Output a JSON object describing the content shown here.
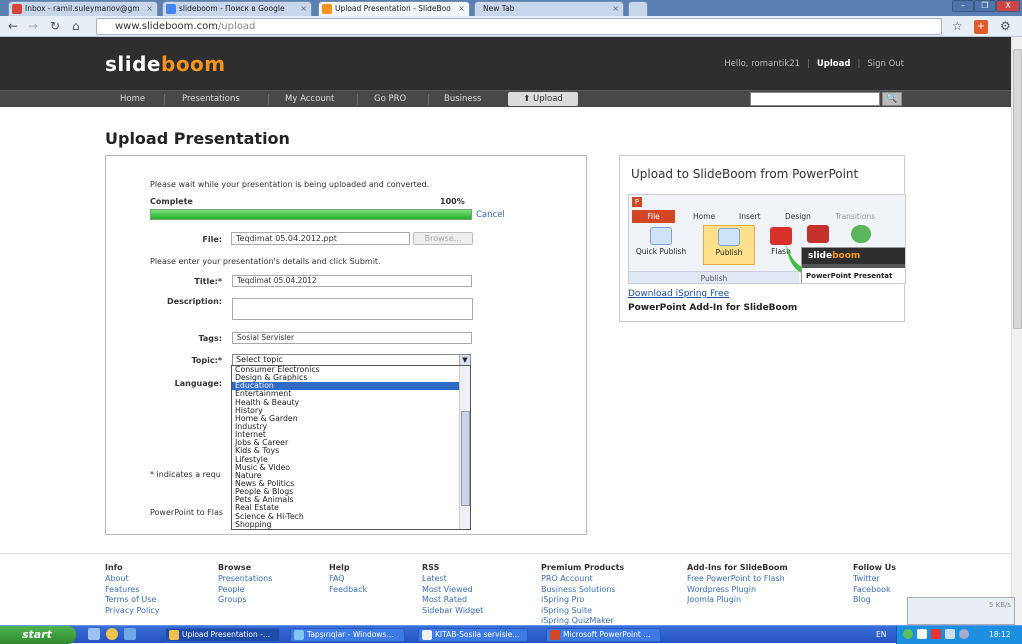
{
  "browser": {
    "tabs": [
      {
        "label": "Inbox - ramil.suleymanov@gm",
        "icon": "gmail-icon",
        "color": "#d44638"
      },
      {
        "label": "slideboom - Поиск в Google",
        "icon": "google-icon",
        "color": "#4285f4"
      },
      {
        "label": "Upload Presentation - SlideBoo",
        "icon": "slideboom-icon",
        "color": "#f7941d"
      },
      {
        "label": "New Tab",
        "icon": "",
        "color": ""
      }
    ],
    "url_host": "www.slideboom.com",
    "url_path": "/upload",
    "window_buttons": [
      "–",
      "❐",
      "X"
    ]
  },
  "site": {
    "logo_a": "slide",
    "logo_b": "boom",
    "greeting": "Hello, romantik21",
    "upload_link": "Upload",
    "signout_link": "Sign Out",
    "nav": [
      "Home",
      "Presentations",
      "My Account",
      "Go PRO",
      "Business"
    ],
    "nav_upload": "Upload",
    "brand_color": "#f7941d"
  },
  "page": {
    "title": "Upload Presentation",
    "wait_text": "Please wait while your presentation is being uploaded and converted.",
    "status_label": "Complete",
    "progress_percent": 100,
    "progress_text": "100%",
    "cancel_link": "Cancel",
    "file_label": "File:",
    "file_value": "Teqdimat 05.04.2012.ppt",
    "browse_label": "Browse...",
    "details_text": "Please enter your presentation's details and click Submit.",
    "title_label": "Title:*",
    "title_value": "Teqdimat 05.04.2012",
    "description_label": "Description:",
    "description_value": "",
    "tags_label": "Tags:",
    "tags_value": "Sosial Servisler",
    "topic_label": "Topic:*",
    "topic_value": "Select topic",
    "language_label": "Language:",
    "required_note": "* indicates a requ",
    "ppt_note": "PowerPoint to Flas",
    "topic_options": [
      "Consumer Electronics",
      "Design & Graphics",
      "Education",
      "Entertainment",
      "Health & Beauty",
      "History",
      "Home & Garden",
      "Industry",
      "Internet",
      "Jobs & Career",
      "Kids & Toys",
      "Lifestyle",
      "Music & Video",
      "Nature",
      "News & Politics",
      "People & Blogs",
      "Pets & Animals",
      "Real Estate",
      "Science & Hi-Tech",
      "Shopping"
    ],
    "topic_selected_index": 2
  },
  "promo": {
    "title": "Upload to SlideBoom from PowerPoint",
    "ribbon_file": "File",
    "ribbon_tabs": [
      "Home",
      "Insert",
      "Design",
      "Transitions"
    ],
    "quick_publish": "Quick Publish",
    "publish": "Publish",
    "flash": "Flash",
    "group_label": "Publish",
    "mini_logo_a": "slide",
    "mini_logo_b": "boom",
    "mini_text": "PowerPoint Presentat",
    "download_link": "Download iSpring Free",
    "download_sub": "PowerPoint Add-In for SlideBoom"
  },
  "footer": {
    "columns": [
      {
        "title": "Info",
        "links": [
          "About",
          "Features",
          "Terms of Use",
          "Privacy Policy"
        ]
      },
      {
        "title": "Browse",
        "links": [
          "Presentations",
          "People",
          "Groups"
        ]
      },
      {
        "title": "Help",
        "links": [
          "FAQ",
          "Feedback"
        ]
      },
      {
        "title": "RSS",
        "links": [
          "Latest",
          "Most Viewed",
          "Most Rated",
          "Sidebar Widget"
        ]
      },
      {
        "title": "Premium Products",
        "links": [
          "PRO Account",
          "Business Solutions",
          "iSpring Pro",
          "iSpring Suite",
          "iSpring QuizMaker"
        ]
      },
      {
        "title": "Add-Ins for SlideBoom",
        "links": [
          "Free PowerPoint to Flash",
          "Wordpress Plugin",
          "Joomla Plugin"
        ]
      },
      {
        "title": "Follow Us",
        "links": [
          "Twitter",
          "Facebook",
          "Blog"
        ]
      }
    ]
  },
  "taskbar": {
    "start": "start",
    "items": [
      "Upload Presentation -...",
      "Tapşırıqlar - Windows...",
      "KITAB-Sosila servisle...",
      "Microsoft PowerPoint ..."
    ],
    "lang": "EN",
    "time": "18:12",
    "net_popup": "5 KB/s"
  }
}
